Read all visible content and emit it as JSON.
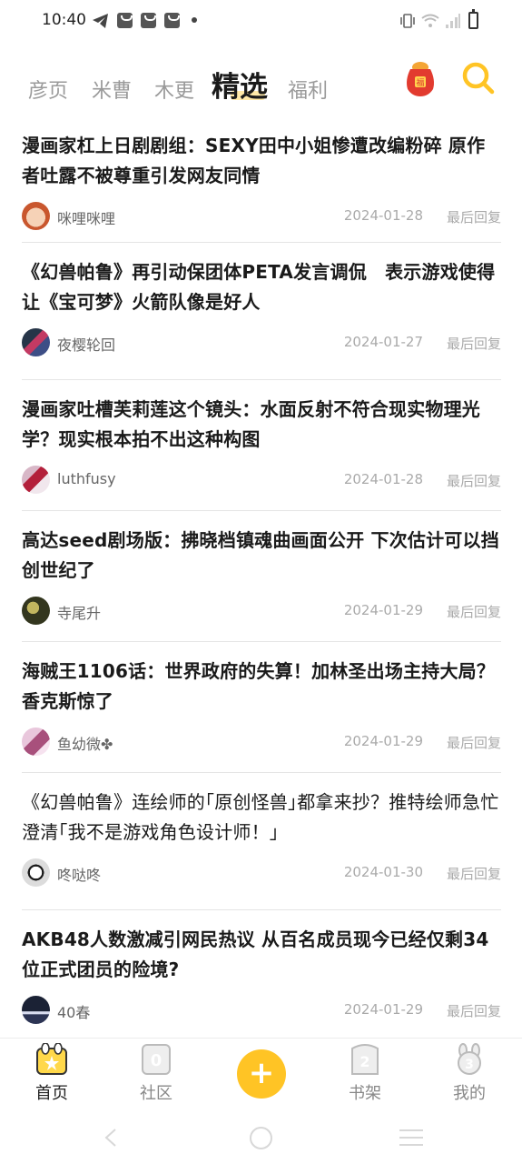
{
  "status_bar": {
    "time": "10:40"
  },
  "top_tabs": {
    "items": [
      "彦页",
      "米曹",
      "木更",
      "精选",
      "福利"
    ],
    "active_index": 3
  },
  "feed": [
    {
      "title": "漫画家杠上日剧剧组：SEXY田中小姐惨遭改编粉碎 原作者吐露不被尊重引发网友同情",
      "author": "咪哩咪哩",
      "date": "2024-01-28",
      "reply_label": "最后回复"
    },
    {
      "title": "《幻兽帕鲁》再引动保团体PETA发言调侃　表示游戏使得让《宝可梦》火箭队像是好人",
      "author": "夜樱轮回",
      "date": "2024-01-27",
      "reply_label": "最后回复"
    },
    {
      "title": "漫画家吐槽芙莉莲这个镜头：水面反射不符合现实物理光学？现实根本拍不出这种构图",
      "author": "luthfusy",
      "date": "2024-01-28",
      "reply_label": "最后回复"
    },
    {
      "title": "高达seed剧场版：拂晓档镇魂曲画面公开 下次估计可以挡创世纪了",
      "author": "寺尾升",
      "date": "2024-01-29",
      "reply_label": "最后回复"
    },
    {
      "title": "海贼王1106话：世界政府的失算！加林圣出场主持大局？香克斯惊了",
      "author": "鱼幼微✤",
      "date": "2024-01-29",
      "reply_label": "最后回复"
    },
    {
      "title": "《幻兽帕鲁》连绘师的｢原创怪兽｣都拿来抄？推特绘师急忙澄清｢我不是游戏角色设计师！｣",
      "author": "咚哒咚",
      "date": "2024-01-30",
      "reply_label": "最后回复"
    },
    {
      "title": "AKB48人数激减引网民热议 从百名成员现今已经仅剩34位正式团员的险境?",
      "author": "40春",
      "date": "2024-01-29",
      "reply_label": "最后回复"
    }
  ],
  "bottom_nav": {
    "items": [
      {
        "label": "首页",
        "icon": "home-icon",
        "active": true
      },
      {
        "label": "社区",
        "icon": "community-icon",
        "active": false
      },
      {
        "label": "",
        "icon": "add-icon",
        "active": false
      },
      {
        "label": "书架",
        "icon": "bookshelf-icon",
        "active": false
      },
      {
        "label": "我的",
        "icon": "profile-icon",
        "active": false
      }
    ],
    "add_symbol": "+"
  },
  "colors": {
    "accent": "#ffc425",
    "tab_highlight": "#ffe9a8",
    "text": "#1a1a1a",
    "muted": "#aaaaaa"
  }
}
